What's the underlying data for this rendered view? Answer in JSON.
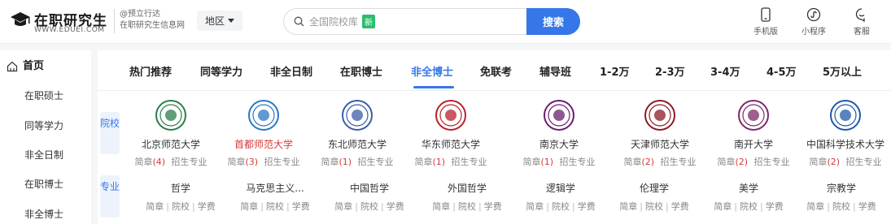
{
  "header": {
    "logo_title": "在职研究生",
    "logo_sub": "WWW.EDUEI.COM",
    "slogan_line1": "@预立行达",
    "slogan_line2": "在职研究生信息网",
    "region_label": "地区",
    "search_placeholder": "全国院校库",
    "new_badge": "新",
    "search_button": "搜索",
    "links": [
      {
        "label": "手机版",
        "icon": "phone-icon"
      },
      {
        "label": "小程序",
        "icon": "mini-program-icon"
      },
      {
        "label": "客服",
        "icon": "customer-service-icon"
      }
    ]
  },
  "sidebar": {
    "home": "首页",
    "items": [
      "在职硕士",
      "同等学力",
      "非全日制",
      "在职博士",
      "非全博士"
    ]
  },
  "tabs": [
    "热门推荐",
    "同等学力",
    "非全日制",
    "在职博士",
    "非全博士",
    "免联考",
    "辅导班",
    "1-2万",
    "2-3万",
    "3-4万",
    "4-5万",
    "5万以上"
  ],
  "active_tab": "非全博士",
  "section_labels": {
    "schools": "院校",
    "majors": "专业"
  },
  "schools": [
    {
      "name": "北京师范大学",
      "brief": "简章",
      "count": "(4)",
      "enroll": "招生专业",
      "color": "#2d7d4a"
    },
    {
      "name": "首都师范大学",
      "brief": "简章",
      "count": "(3)",
      "enroll": "招生专业",
      "color": "#2a78c8"
    },
    {
      "name": "东北师范大学",
      "brief": "简章",
      "count": "(1)",
      "enroll": "招生专业",
      "color": "#3b5ea8"
    },
    {
      "name": "华东师范大学",
      "brief": "简章",
      "count": "(1)",
      "enroll": "招生专业",
      "color": "#b8222e"
    },
    {
      "name": "南京大学",
      "brief": "简章",
      "count": "(1)",
      "enroll": "招生专业",
      "color": "#6a1f6e"
    },
    {
      "name": "天津师范大学",
      "brief": "简章",
      "count": "(2)",
      "enroll": "招生专业",
      "color": "#8c1c24"
    },
    {
      "name": "南开大学",
      "brief": "简章",
      "count": "(2)",
      "enroll": "招生专业",
      "color": "#7b2a6a"
    },
    {
      "name": "中国科学技术大学",
      "brief": "简章",
      "count": "(2)",
      "enroll": "招生专业",
      "color": "#1f5aa8"
    }
  ],
  "majors": [
    {
      "name": "哲学",
      "links": [
        "简章",
        "院校",
        "学费"
      ]
    },
    {
      "name": "马克思主义...",
      "links": [
        "简章",
        "院校",
        "学费"
      ]
    },
    {
      "name": "中国哲学",
      "links": [
        "简章",
        "院校",
        "学费"
      ]
    },
    {
      "name": "外国哲学",
      "links": [
        "简章",
        "院校",
        "学费"
      ]
    },
    {
      "name": "逻辑学",
      "links": [
        "简章",
        "院校",
        "学费"
      ]
    },
    {
      "name": "伦理学",
      "links": [
        "简章",
        "院校",
        "学费"
      ]
    },
    {
      "name": "美学",
      "links": [
        "简章",
        "院校",
        "学费"
      ]
    },
    {
      "name": "宗教学",
      "links": [
        "简章",
        "院校",
        "学费"
      ]
    }
  ]
}
